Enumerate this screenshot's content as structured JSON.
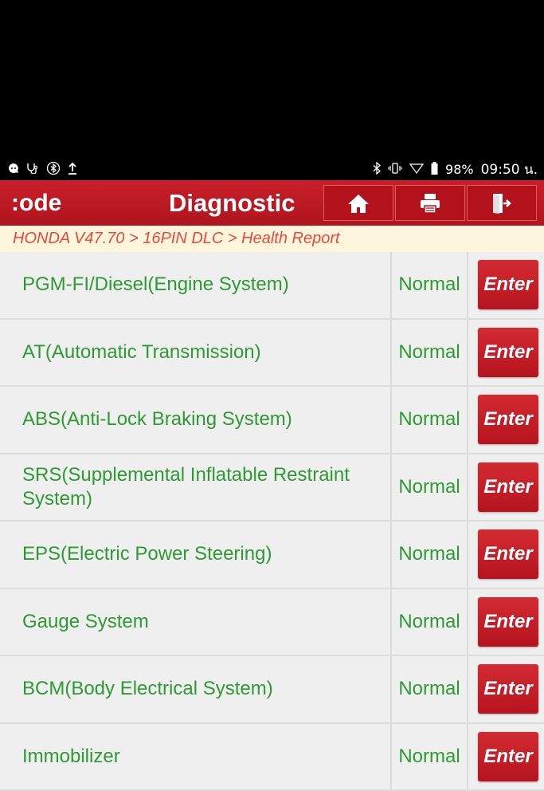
{
  "status_bar": {
    "battery": "98%",
    "time": "09:50 น."
  },
  "title_bar": {
    "left_label": "ode",
    "left_prefix": ":",
    "title": "Diagnostic",
    "buttons": [
      "home-icon",
      "printer-icon",
      "exit-icon"
    ]
  },
  "breadcrumb": "HONDA V47.70 > 16PIN DLC > Health Report",
  "systems": [
    {
      "name": "PGM-FI/Diesel(Engine System)",
      "status": "Normal",
      "action": "Enter"
    },
    {
      "name": "AT(Automatic Transmission)",
      "status": "Normal",
      "action": "Enter"
    },
    {
      "name": "ABS(Anti-Lock Braking System)",
      "status": "Normal",
      "action": "Enter"
    },
    {
      "name": "SRS(Supplemental Inflatable Restraint System)",
      "status": "Normal",
      "action": "Enter"
    },
    {
      "name": "EPS(Electric Power Steering)",
      "status": "Normal",
      "action": "Enter"
    },
    {
      "name": "Gauge System",
      "status": "Normal",
      "action": "Enter"
    },
    {
      "name": "BCM(Body Electrical System)",
      "status": "Normal",
      "action": "Enter"
    },
    {
      "name": "Immobilizer",
      "status": "Normal",
      "action": "Enter"
    }
  ],
  "colors": {
    "brand_red": "#c8202a",
    "status_green": "#2e9a33",
    "breadcrumb_text": "#e8493d"
  }
}
